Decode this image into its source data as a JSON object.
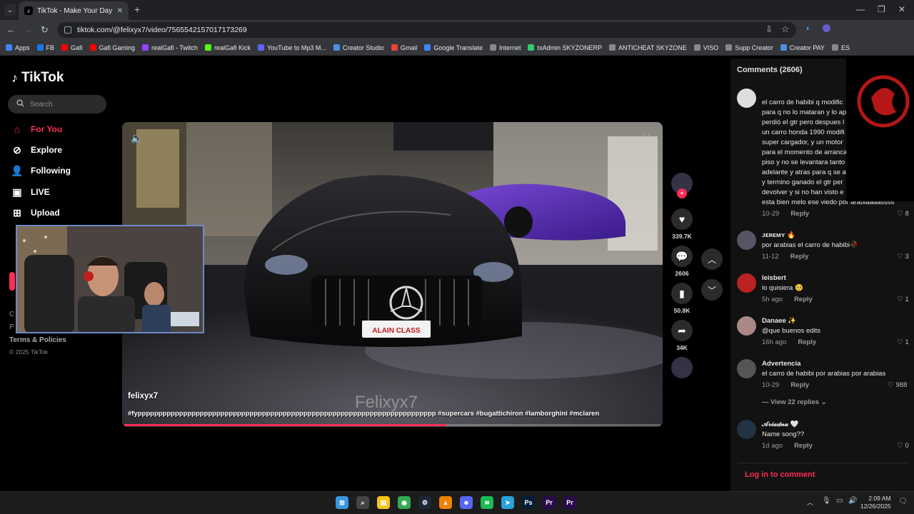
{
  "browser": {
    "tab_title": "TikTok - Make Your Day",
    "url": "tiktok.com/@felixyx7/video/7565542157017173269"
  },
  "bookmarks": [
    {
      "label": "Apps",
      "color": "#4285f4"
    },
    {
      "label": "FB",
      "color": "#1877f2"
    },
    {
      "label": "Gafi",
      "color": "#ff0000"
    },
    {
      "label": "Gafi Gaming",
      "color": "#ff0000"
    },
    {
      "label": "realGafi - Twitch",
      "color": "#9146ff"
    },
    {
      "label": "realGafi Kick",
      "color": "#53fc18"
    },
    {
      "label": "YouTube to Mp3 M...",
      "color": "#5865f2"
    },
    {
      "label": "Creator Studio",
      "color": "#4a90e2"
    },
    {
      "label": "Gmail",
      "color": "#ea4335"
    },
    {
      "label": "Google Translate",
      "color": "#4285f4"
    },
    {
      "label": "Internet",
      "color": "#888888"
    },
    {
      "label": "txAdmin SKYZONERP",
      "color": "#2ecc71"
    },
    {
      "label": "ANTICHEAT SKYZONE",
      "color": "#888888"
    },
    {
      "label": "VISO",
      "color": "#888888"
    },
    {
      "label": "Supp Creator",
      "color": "#888888"
    },
    {
      "label": "Creator PAY",
      "color": "#4a90e2"
    },
    {
      "label": "ES",
      "color": "#888888"
    }
  ],
  "sidebar": {
    "logo": "TikTok",
    "search_placeholder": "Search",
    "items": [
      {
        "label": "For You"
      },
      {
        "label": "Explore"
      },
      {
        "label": "Following"
      },
      {
        "label": "LIVE"
      },
      {
        "label": "Upload"
      }
    ],
    "terms": "Terms & Policies",
    "copyright": "© 2025 TikTok",
    "frag_c": "C",
    "frag_p": "P"
  },
  "video": {
    "author": "felixyx7",
    "watermark": "Felixyx7",
    "caption": "#fypppppppppppppppppppppppppppppppppppppppppppppppppppppppppppppppppppppppp #supercars #bugattichiron #lamborghini #mclaren",
    "progress": 0.6,
    "plate_text": "ALAIN CLASS"
  },
  "actions": {
    "likes": "339.7K",
    "comments": "2606",
    "saves": "50.8K",
    "shares": "34K"
  },
  "comments_panel": {
    "title": "Comments (2606)",
    "login": "Log in to comment",
    "view_replies": "View 22 replies",
    "reply_label": "Reply",
    "items": [
      {
        "user": "",
        "lines": [
          "el carro de habibi q modific",
          "para q no lo mataran y lo ap",
          "perdió el gtr pero despues l",
          "un carro honda 1990 modifi",
          "super cargador, y un motor",
          "para el momento de arranca",
          "piso y no se levantara tanto",
          "adelante y atras para q se a",
          "y termino ganado el gtr per",
          "devolver y si no han visto e",
          "esta bien melo ese viedo por arabiaaaassss"
        ],
        "date": "10-29",
        "likes": "8"
      },
      {
        "user": "ᴊᴇʀᴇᴍʏ 🔥",
        "lines": [
          "por arabias el carro de habibi🥀"
        ],
        "date": "11-12",
        "likes": "3"
      },
      {
        "user": "leisbert",
        "lines": [
          "lo quisiera 🥺"
        ],
        "date": "5h ago",
        "likes": "1"
      },
      {
        "user": "Danaee ✨",
        "lines": [
          "@que buenos edits"
        ],
        "date": "16h ago",
        "likes": "1"
      },
      {
        "user": "Advertencia",
        "lines": [
          "el carro de habibi por arabias por arabias"
        ],
        "date": "10-29",
        "likes": "988"
      },
      {
        "user": "𝒜𝓇𝒾𝒶𝒹𝓃𝒶 🤍",
        "lines": [
          "Name song??"
        ],
        "date": "1d ago",
        "likes": "0"
      }
    ]
  },
  "taskbar": {
    "time": "2:09 AM",
    "date": "12/26/2025",
    "apps": [
      {
        "name": "start",
        "color": "#3a96dd"
      },
      {
        "name": "search",
        "color": "#444444"
      },
      {
        "name": "files",
        "color": "#f5c518"
      },
      {
        "name": "chrome",
        "color": "#34a853"
      },
      {
        "name": "steam",
        "color": "#1b2838"
      },
      {
        "name": "vlc",
        "color": "#f08000"
      },
      {
        "name": "discord",
        "color": "#5865f2"
      },
      {
        "name": "spotify",
        "color": "#1db954"
      },
      {
        "name": "telegram",
        "color": "#2aa1da"
      },
      {
        "name": "photoshop",
        "color": "#001e36"
      },
      {
        "name": "premiere",
        "color": "#2a0a4a"
      },
      {
        "name": "premiere2",
        "color": "#2a0a4a"
      }
    ]
  }
}
